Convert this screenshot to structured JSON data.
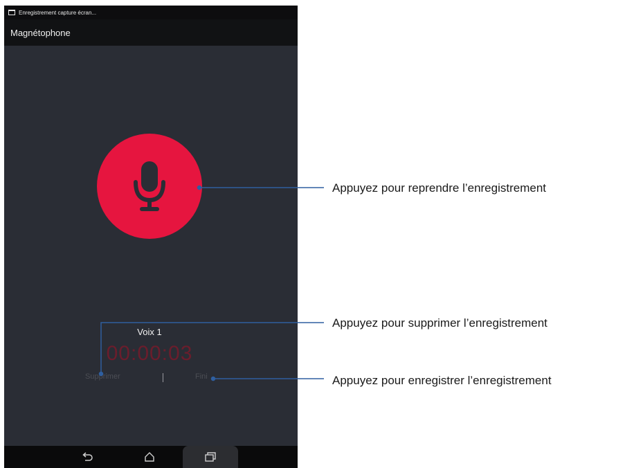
{
  "status_bar": {
    "notification": "Enregistrement capture écran..."
  },
  "app_bar": {
    "title": "Magnétophone"
  },
  "recorder": {
    "record_button_icon": "microphone-icon",
    "accent_color": "#e6153f",
    "voice_label": "Voix 1",
    "timer": "00:00:03",
    "delete_label": "Supprimer",
    "finish_label": "Fini"
  },
  "nav_bar": {
    "back_icon": "back-icon",
    "home_icon": "home-icon",
    "recent_icon": "recent-apps-icon"
  },
  "callouts": {
    "resume": "Appuyez pour reprendre l’enregistrement",
    "delete": "Appuyez pour supprimer l’enregistrement",
    "save": "Appuyez pour enregistrer l’enregistrement",
    "line_color": "#2f5fa0"
  }
}
